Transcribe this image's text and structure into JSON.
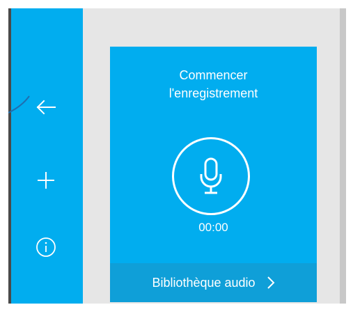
{
  "sidebar": {
    "back_icon": "arrow-left-icon",
    "add_icon": "plus-icon",
    "info_icon": "info-icon"
  },
  "recorder": {
    "title": "Commencer\nl'enregistrement",
    "mic_icon": "microphone-icon",
    "timer": "00:00"
  },
  "library": {
    "label": "Bibliothèque audio",
    "chevron_icon": "chevron-right-icon"
  },
  "colors": {
    "accent": "#01adef",
    "library_bar": "#0f9fd8",
    "background": "#e6e6e6"
  }
}
